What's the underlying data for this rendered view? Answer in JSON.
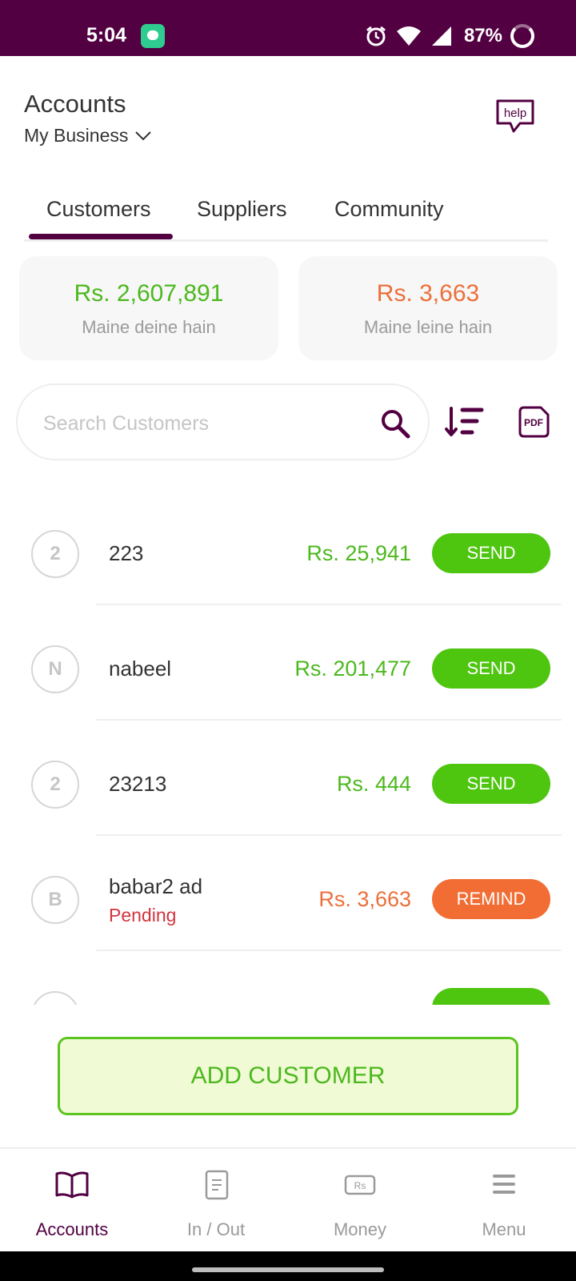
{
  "status_bar": {
    "time": "5:04",
    "battery": "87%"
  },
  "header": {
    "title": "Accounts",
    "business": "My Business",
    "help_text": "help"
  },
  "tabs": [
    {
      "label": "Customers",
      "active": true
    },
    {
      "label": "Suppliers",
      "active": false
    },
    {
      "label": "Community",
      "active": false
    }
  ],
  "summary": {
    "given": {
      "amount": "Rs. 2,607,891",
      "label": "Maine deine hain"
    },
    "received": {
      "amount": "Rs. 3,663",
      "label": "Maine leine hain"
    }
  },
  "search": {
    "placeholder": "Search Customers",
    "value": ""
  },
  "pdf_label": "PDF",
  "customers": [
    {
      "initial": "2",
      "name": "223",
      "amount": "Rs. 25,941",
      "action": "SEND",
      "status": ""
    },
    {
      "initial": "N",
      "name": "nabeel",
      "amount": "Rs. 201,477",
      "action": "SEND",
      "status": ""
    },
    {
      "initial": "2",
      "name": "23213",
      "amount": "Rs. 444",
      "action": "SEND",
      "status": ""
    },
    {
      "initial": "B",
      "name": "babar2 ad",
      "amount": "Rs. 3,663",
      "action": "REMIND",
      "status": "Pending"
    }
  ],
  "add_button": "ADD CUSTOMER",
  "bottom_nav": [
    {
      "label": "Accounts",
      "icon": "book-icon",
      "active": true
    },
    {
      "label": "In / Out",
      "icon": "ledger-icon",
      "active": false
    },
    {
      "label": "Money",
      "icon": "rupee-note-icon",
      "active": false
    },
    {
      "label": "Menu",
      "icon": "hamburger-icon",
      "active": false
    }
  ],
  "rupee_icon_text": "Rs",
  "colors": {
    "brand": "#520042",
    "positive": "#4cb81e",
    "negative": "#ec6f3a",
    "send": "#4ec50f",
    "remind": "#f26d33",
    "pending": "#d2353f"
  }
}
